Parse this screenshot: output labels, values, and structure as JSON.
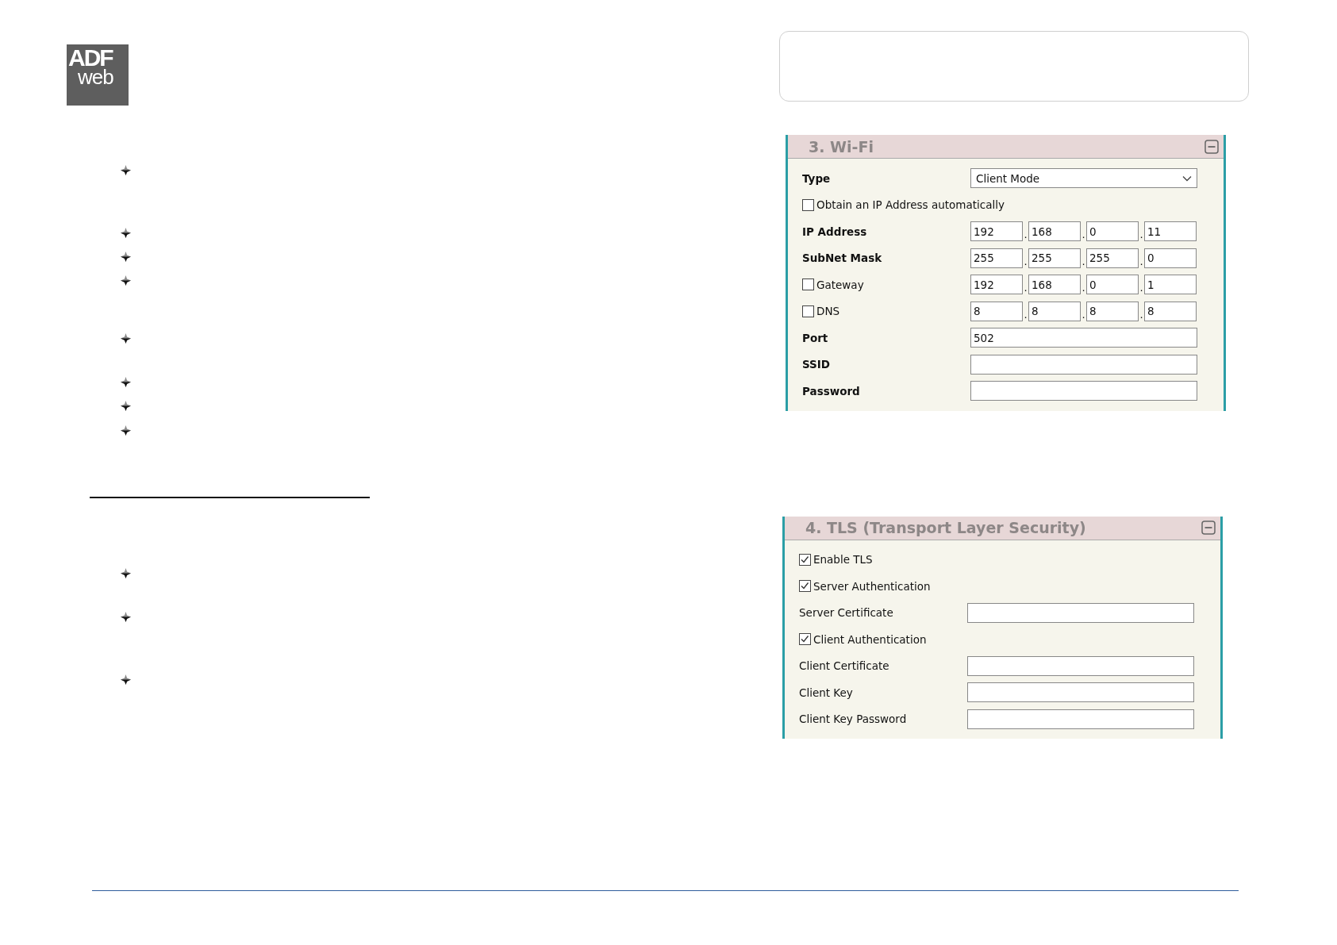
{
  "logo": {
    "top": "ADF",
    "bottom": "web"
  },
  "wifi_panel": {
    "title": "3. Wi-Fi",
    "bold_labels": true,
    "rows": [
      {
        "kind": "select",
        "label": "Type",
        "value": "Client Mode"
      },
      {
        "kind": "checkbox",
        "label": "Obtain an IP Address automatically",
        "checked": false
      },
      {
        "kind": "ip",
        "label": "IP Address",
        "octets": [
          "192",
          "168",
          "0",
          "11"
        ],
        "separators": [
          ".",
          ".",
          "."
        ]
      },
      {
        "kind": "ip",
        "label": "SubNet Mask",
        "octets": [
          "255",
          "255",
          "255",
          "0"
        ],
        "separators": [
          ".",
          ".",
          "."
        ]
      },
      {
        "kind": "checkbox-ip",
        "label": "Gateway",
        "checked": false,
        "octets": [
          "192",
          "168",
          "0",
          "1"
        ],
        "separators": [
          ".",
          ".",
          "."
        ]
      },
      {
        "kind": "checkbox-ip",
        "label": "DNS",
        "checked": false,
        "octets": [
          "8",
          "8",
          "8",
          "8"
        ],
        "separators": [
          ".",
          ".",
          "."
        ]
      },
      {
        "kind": "text",
        "label": "Port",
        "value": "502"
      },
      {
        "kind": "text",
        "label": "SSID"
      },
      {
        "kind": "text",
        "label": "Password"
      }
    ]
  },
  "tls_panel": {
    "title": "4. TLS (Transport Layer Security)",
    "bold_labels": false,
    "rows": [
      {
        "kind": "checkbox",
        "label": "Enable TLS",
        "checked": true
      },
      {
        "kind": "checkbox",
        "label": "Server Authentication",
        "checked": true
      },
      {
        "kind": "text",
        "label": "Server Certificate"
      },
      {
        "kind": "checkbox",
        "label": "Client Authentication",
        "checked": true
      },
      {
        "kind": "text",
        "label": "Client Certificate"
      },
      {
        "kind": "text",
        "label": "Client Key"
      },
      {
        "kind": "text",
        "label": "Client Key Password"
      }
    ]
  }
}
